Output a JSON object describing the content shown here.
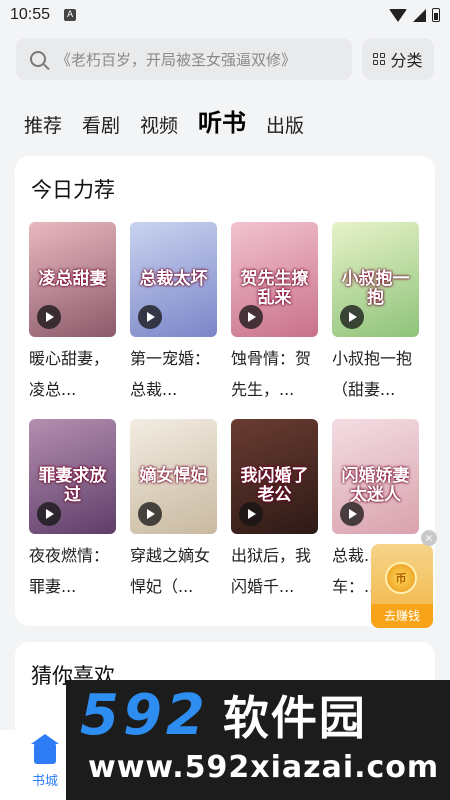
{
  "status_bar": {
    "time": "10:55",
    "notification": "A"
  },
  "search": {
    "placeholder": "《老朽百岁，开局被圣女强逼双修》",
    "classify_label": "分类"
  },
  "tabs": [
    {
      "label": "推荐",
      "active": false
    },
    {
      "label": "看剧",
      "active": false
    },
    {
      "label": "视频",
      "active": false
    },
    {
      "label": "听书",
      "active": true
    },
    {
      "label": "出版",
      "active": false
    }
  ],
  "recommend": {
    "title": "今日力荐",
    "books": [
      {
        "title": "暖心甜妻，凌总...",
        "cover_text": "凌总甜妻",
        "colors": [
          "#e9b9c1",
          "#8a5a6a"
        ]
      },
      {
        "title": "第一宠婚：总裁...",
        "cover_text": "总裁太坏",
        "colors": [
          "#c9d3ef",
          "#7b86c9"
        ]
      },
      {
        "title": "蚀骨情：贺先生，...",
        "cover_text": "贺先生撩乱来",
        "colors": [
          "#f2c3cf",
          "#c9718a"
        ]
      },
      {
        "title": "小叔抱一抱（甜妻...",
        "cover_text": "小叔抱一抱",
        "colors": [
          "#e7f2c8",
          "#8ec37a"
        ]
      },
      {
        "title": "夜夜燃情：罪妻...",
        "cover_text": "罪妻求放过",
        "colors": [
          "#b48fb0",
          "#5e3e6a"
        ]
      },
      {
        "title": "穿越之嫡女悍妃（...",
        "cover_text": "嫡女悍妃",
        "colors": [
          "#f2ece2",
          "#c9b9a0"
        ]
      },
      {
        "title": "出狱后，我闪婚千...",
        "cover_text": "我闪婚了老公",
        "colors": [
          "#6a3c32",
          "#2e1a16"
        ]
      },
      {
        "title": "总裁...车：...",
        "cover_text": "闪婚娇妻太迷人",
        "colors": [
          "#f3dde2",
          "#d9a2ad"
        ]
      }
    ]
  },
  "guess": {
    "title": "猜你喜欢"
  },
  "float_badge": {
    "label": "去赚钱",
    "coin_text": "币",
    "close": "×"
  },
  "bottom_nav": {
    "home_label": "书城"
  },
  "watermark": {
    "number": "592",
    "brand": "软件园",
    "url": "www.592xiazai.com"
  }
}
